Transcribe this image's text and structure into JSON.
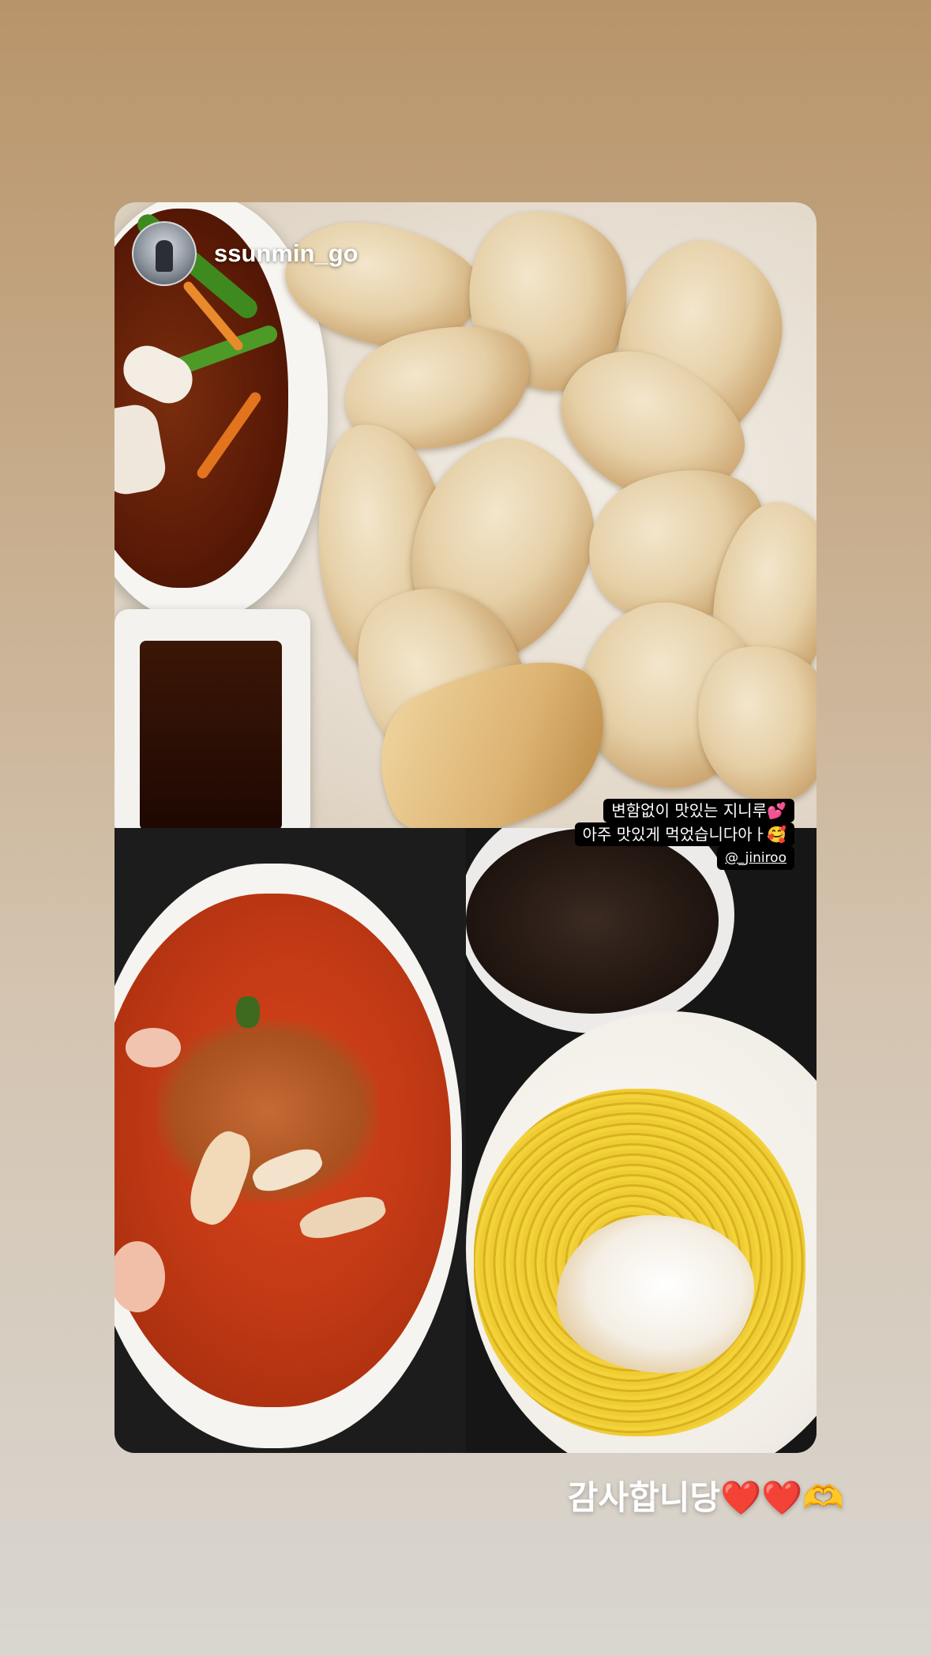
{
  "story": {
    "username": "ssunmin_go",
    "caption": {
      "line1": "변함없이 맛있는 지니루💕",
      "line2": "아주 맛있게 먹었습니다아ㅏ🥰",
      "mention": "@_jiniroo"
    },
    "footer_text": "감사합니당",
    "footer_emojis": "❤️❤️🫶"
  },
  "photos": {
    "top": "fried-pork-tangsuyuk-photo",
    "bottom_left": "jjamppong-photo",
    "bottom_right": "jjajang-noodles-with-egg-photo"
  }
}
